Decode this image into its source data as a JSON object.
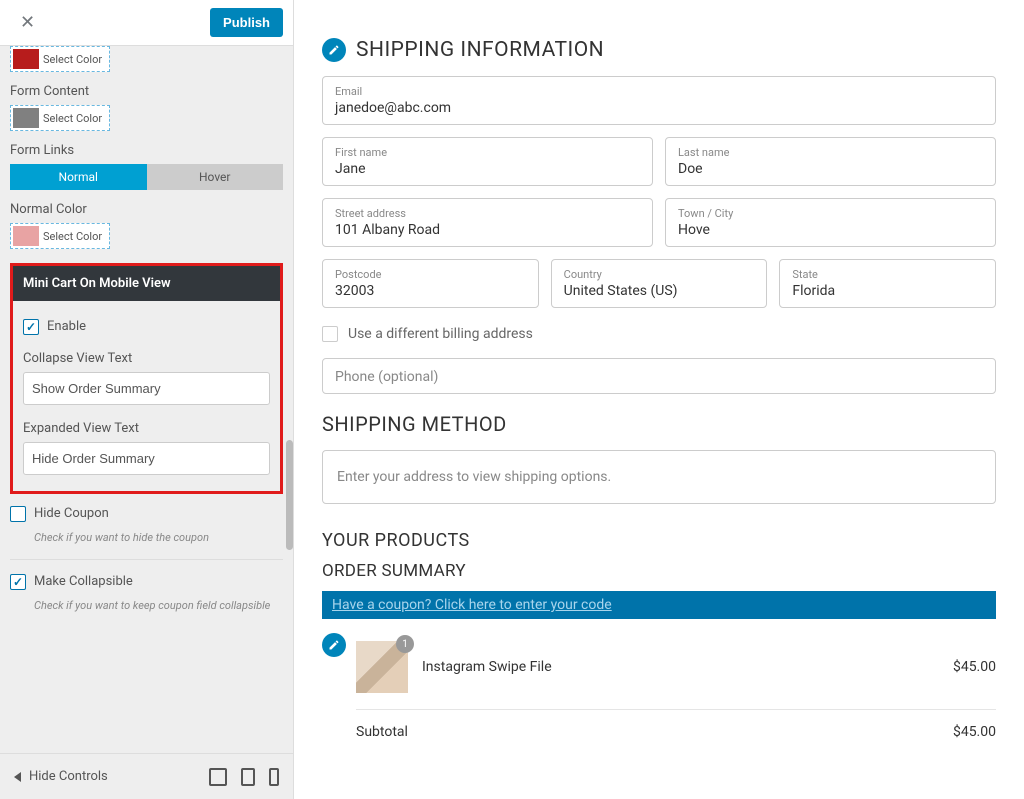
{
  "sidebar": {
    "publish_label": "Publish",
    "form_content_label": "Form Content",
    "form_links_label": "Form Links",
    "normal_tab": "Normal",
    "hover_tab": "Hover",
    "normal_color_label": "Normal Color",
    "select_color_text": "Select Color",
    "minicart_header": "Mini Cart On Mobile View",
    "enable_label": "Enable",
    "collapse_view_label": "Collapse View Text",
    "collapse_view_value": "Show Order Summary",
    "expanded_view_label": "Expanded View Text",
    "expanded_view_value": "Hide Order Summary",
    "hide_coupon_label": "Hide Coupon",
    "hide_coupon_desc": "Check if you want to hide the coupon",
    "make_collapsible_label": "Make Collapsible",
    "make_collapsible_desc": "Check if you want to keep coupon field collapsible",
    "hide_controls": "Hide Controls"
  },
  "preview": {
    "shipping_info_title": "SHIPPING INFORMATION",
    "email": {
      "label": "Email",
      "value": "janedoe@abc.com"
    },
    "first_name": {
      "label": "First name",
      "value": "Jane"
    },
    "last_name": {
      "label": "Last name",
      "value": "Doe"
    },
    "street": {
      "label": "Street address",
      "value": "101 Albany Road"
    },
    "town": {
      "label": "Town / City",
      "value": "Hove"
    },
    "postcode": {
      "label": "Postcode",
      "value": "32003"
    },
    "country": {
      "label": "Country",
      "value": "United States (US)"
    },
    "state": {
      "label": "State",
      "value": "Florida"
    },
    "diff_billing": "Use a different billing address",
    "phone_placeholder": "Phone (optional)",
    "shipping_method_title": "SHIPPING METHOD",
    "shipping_method_msg": "Enter your address to view shipping options.",
    "your_products": "YOUR PRODUCTS",
    "order_summary": "ORDER SUMMARY",
    "coupon_text": "Have a coupon? Click here to enter your code",
    "product": {
      "name": "Instagram Swipe File",
      "qty": "1",
      "price": "$45.00"
    },
    "subtotal_label": "Subtotal",
    "subtotal_value": "$45.00"
  }
}
